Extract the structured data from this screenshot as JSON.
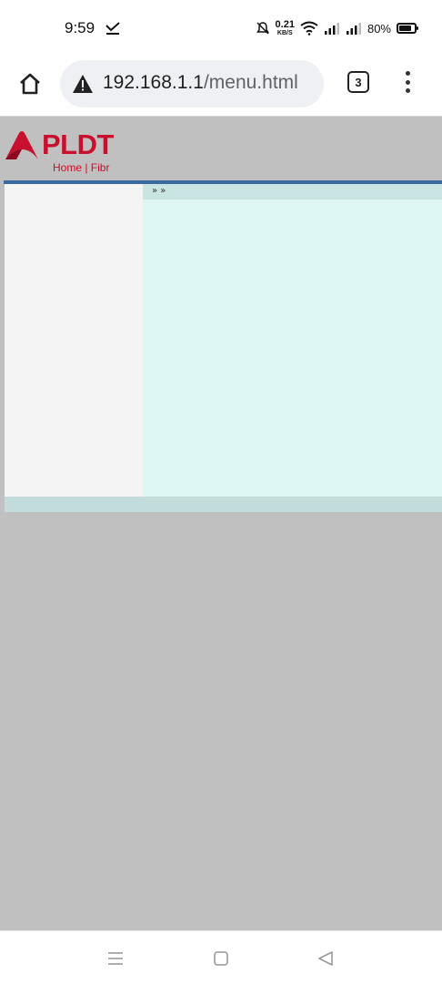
{
  "status_bar": {
    "time": "9:59",
    "net_speed_value": "0.21",
    "net_speed_unit": "KB/S",
    "battery_percent": "80%",
    "battery_level": 0.8
  },
  "browser": {
    "url_host": "192.168.1.1",
    "url_path": "/menu.html",
    "tab_count": "3"
  },
  "page": {
    "logo_word": "PLDT",
    "logo_tagline": "Home | Fibr",
    "breadcrumb": "» »",
    "brand_color": "#c8102e",
    "frame_line_color": "#3c6a9e"
  },
  "icons": {
    "home": "home-icon",
    "warning": "warning-icon",
    "menu": "more-vert-icon",
    "nav_recents": "menu-lines-icon",
    "nav_home": "square-icon",
    "nav_back": "triangle-back-icon"
  }
}
